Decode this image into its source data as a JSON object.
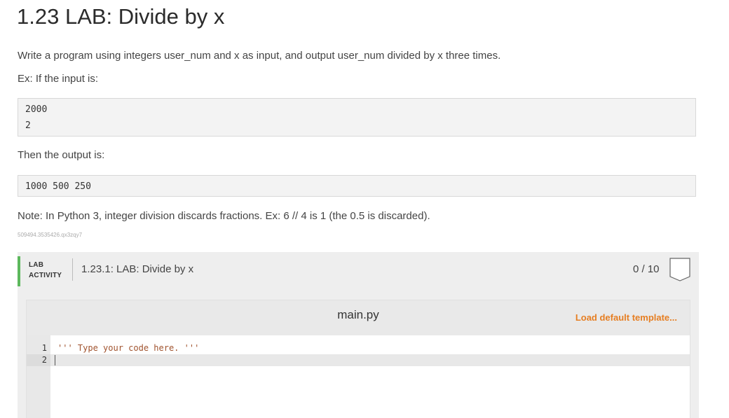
{
  "page": {
    "title": "1.23 LAB: Divide by x",
    "description": "Write a program using integers user_num and x as input, and output user_num divided by x three times.",
    "example_intro": "Ex: If the input is:",
    "example_input_lines": [
      "2000",
      "2"
    ],
    "output_intro": "Then the output is:",
    "example_output": "1000 500 250",
    "note": "Note: In Python 3, integer division discards fractions. Ex: 6 // 4 is 1 (the 0.5 is discarded).",
    "tracking_id": "509494.3535426.qx3zqy7"
  },
  "lab_activity": {
    "tag_line1": "LAB",
    "tag_line2": "ACTIVITY",
    "title": "1.23.1: LAB: Divide by x",
    "score": "0 / 10",
    "accent_color": "#5cb85c",
    "badge_icon": "shield-badge-icon"
  },
  "editor": {
    "filename": "main.py",
    "load_template_label": "Load default template...",
    "load_template_color": "#e67e22",
    "lines": [
      {
        "number": "1",
        "code": "''' Type your code here. '''"
      },
      {
        "number": "2",
        "code": ""
      }
    ]
  }
}
